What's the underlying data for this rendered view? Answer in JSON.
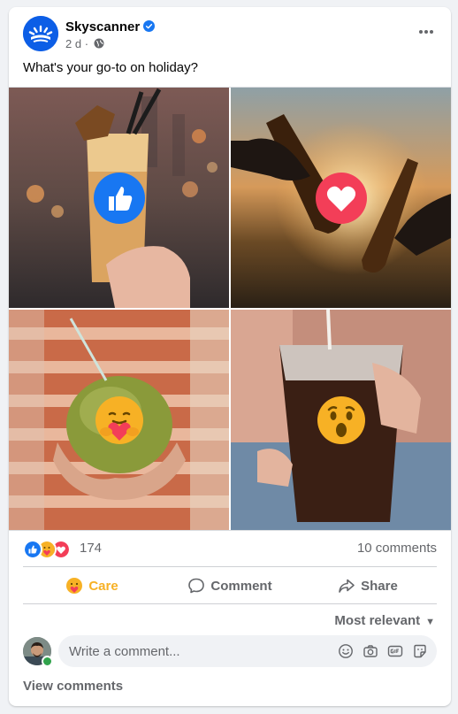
{
  "post": {
    "page_name": "Skyscanner",
    "time": "2 d",
    "separator": "·",
    "caption": "What's your go-to on holiday?"
  },
  "icons": {
    "verified": "verified-badge-icon",
    "privacy": "globe-icon",
    "more": "more-horizontal-icon",
    "reactions": [
      "like-reaction-icon",
      "care-reaction-icon",
      "love-reaction-icon"
    ],
    "tile_overlays": [
      "like-reaction-icon",
      "love-reaction-icon",
      "care-reaction-icon",
      "wow-reaction-icon"
    ]
  },
  "summary": {
    "reaction_count": "174",
    "comment_count": "10 comments"
  },
  "actions": {
    "care_label": "Care",
    "comment_label": "Comment",
    "share_label": "Share"
  },
  "comments": {
    "sort_label": "Most relevant",
    "placeholder": "Write a comment...",
    "view_comments": "View comments"
  },
  "colors": {
    "brand": "#0c5ee6",
    "care": "#f7b125",
    "like": "#1877f2",
    "love": "#f33e58",
    "online": "#31a24c"
  }
}
